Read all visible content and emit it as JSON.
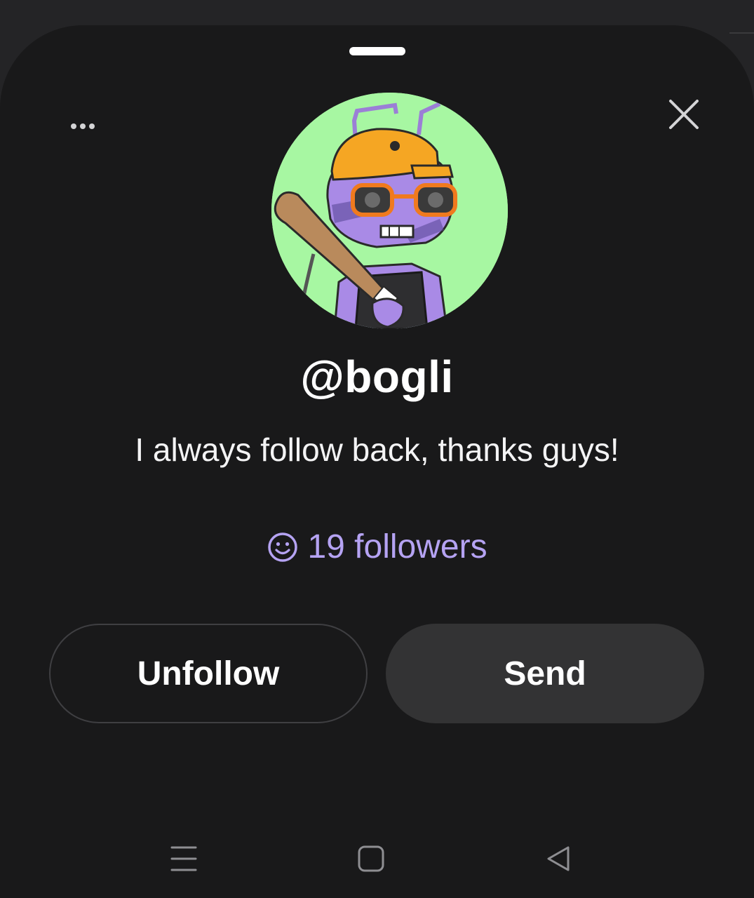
{
  "profile": {
    "username": "@bogli",
    "bio": "I always follow back, thanks guys!",
    "followers_label": "19 followers",
    "avatar": "pixel-art ant with orange cap, orange glasses and baseball bat on green background"
  },
  "actions": {
    "unfollow_label": "Unfollow",
    "send_label": "Send"
  },
  "icons": {
    "more": "more-horizontal-icon",
    "close": "close-icon",
    "followers": "smiley-icon",
    "nav_recents": "menu-lines-icon",
    "nav_home": "square-home-icon",
    "nav_back": "triangle-back-icon"
  },
  "colors": {
    "sheet_background": "#19191a",
    "accent_followers": "#b5a3f3",
    "send_button": "#333334",
    "avatar_background": "#a7f7a2"
  }
}
